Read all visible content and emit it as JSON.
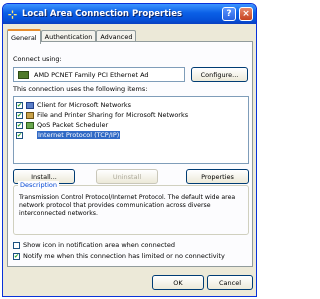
{
  "window": {
    "title": "Local Area Connection Properties",
    "help_glyph": "?",
    "close_glyph": "×",
    "icon": "network-connection-icon"
  },
  "tabs": [
    {
      "label": "General",
      "active": true
    },
    {
      "label": "Authentication",
      "active": false
    },
    {
      "label": "Advanced",
      "active": false
    }
  ],
  "general": {
    "connect_using_label": "Connect using:",
    "adapter_name": "AMD PCNET Family PCI Ethernet Ad",
    "configure_button": "Configure...",
    "items_label": "This connection uses the following items:",
    "items": [
      {
        "label": "Client for Microsoft Networks",
        "checked": true,
        "icon": "network-client-icon",
        "selected": false
      },
      {
        "label": "File and Printer Sharing for Microsoft Networks",
        "checked": true,
        "icon": "file-printer-sharing-icon",
        "selected": false
      },
      {
        "label": "QoS Packet Scheduler",
        "checked": true,
        "icon": "qos-scheduler-icon",
        "selected": false
      },
      {
        "label": "Internet Protocol (TCP/IP)",
        "checked": true,
        "icon": "protocol-icon",
        "selected": true
      }
    ],
    "install_button": "Install...",
    "uninstall_button": "Uninstall",
    "properties_button": "Properties",
    "description_label": "Description",
    "description_text": "Transmission Control Protocol/Internet Protocol. The default wide area network protocol that provides communication across diverse interconnected networks.",
    "show_icon_label": "Show icon in notification area when connected",
    "show_icon_checked": false,
    "notify_label": "Notify me when this connection has limited or no connectivity",
    "notify_checked": true
  },
  "footer": {
    "ok_button": "OK",
    "cancel_button": "Cancel"
  }
}
